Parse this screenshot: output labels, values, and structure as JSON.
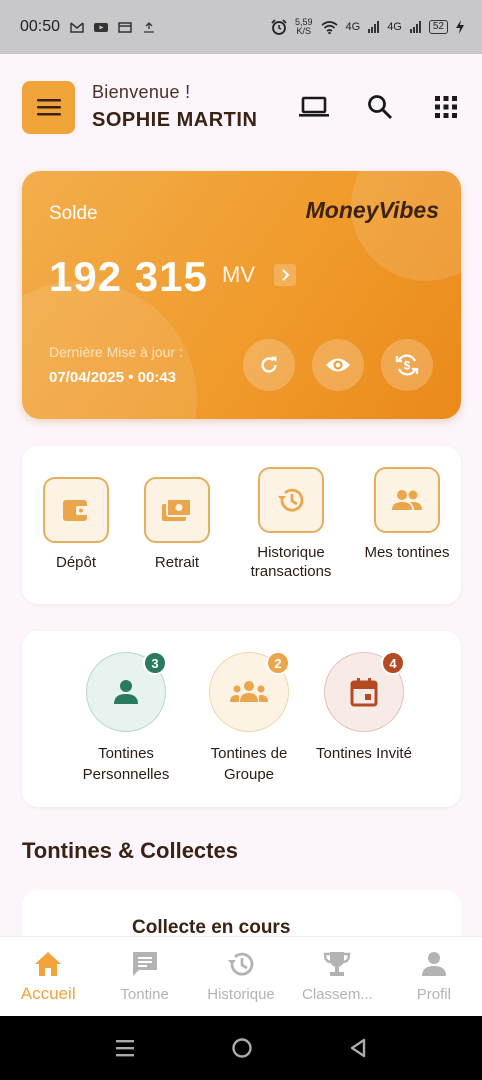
{
  "status_bar": {
    "time": "00:50",
    "speed": "5,59",
    "speed_unit": "K/S",
    "network_1": "4G",
    "network_2": "4G",
    "battery": "52"
  },
  "header": {
    "greeting": "Bienvenue !",
    "user_name": "SOPHIE MARTIN"
  },
  "balance_card": {
    "label": "Solde",
    "brand": "MoneyVibes",
    "amount": "192 315",
    "unit": "MV",
    "last_update_label": "Dernière Mise à jour :",
    "last_update_value": "07/04/2025 • 00:43"
  },
  "quick_actions": [
    {
      "label": "Dépôt",
      "icon": "wallet-icon"
    },
    {
      "label": "Retrait",
      "icon": "cash-icon"
    },
    {
      "label": "Historique transactions",
      "icon": "history-icon"
    },
    {
      "label": "Mes tontines",
      "icon": "people-icon"
    }
  ],
  "tontine_types": [
    {
      "label": "Tontines Personnelles",
      "count": "3",
      "color": "#2a7a5e",
      "bg": "#e7f3ee",
      "border": "#b7d8c9"
    },
    {
      "label": "Tontines de Groupe",
      "count": "2",
      "color": "#eba54a",
      "bg": "#fdf3e4",
      "border": "#f1d6a8"
    },
    {
      "label": "Tontines Invité",
      "count": "4",
      "color": "#b54a22",
      "bg": "#f8ebe7",
      "border": "#e6c2b4"
    }
  ],
  "section_title": "Tontines & Collectes",
  "collect_card": {
    "title": "Collecte en cours"
  },
  "bottom_nav": [
    {
      "label": "Accueil",
      "icon": "home-icon",
      "active": true
    },
    {
      "label": "Tontine",
      "icon": "message-icon",
      "active": false
    },
    {
      "label": "Historique",
      "icon": "history-icon",
      "active": false
    },
    {
      "label": "Classem...",
      "icon": "trophy-icon",
      "active": false
    },
    {
      "label": "Profil",
      "icon": "person-icon",
      "active": false
    }
  ],
  "colors": {
    "accent": "#f0a43a",
    "dark_text": "#3a2214"
  }
}
